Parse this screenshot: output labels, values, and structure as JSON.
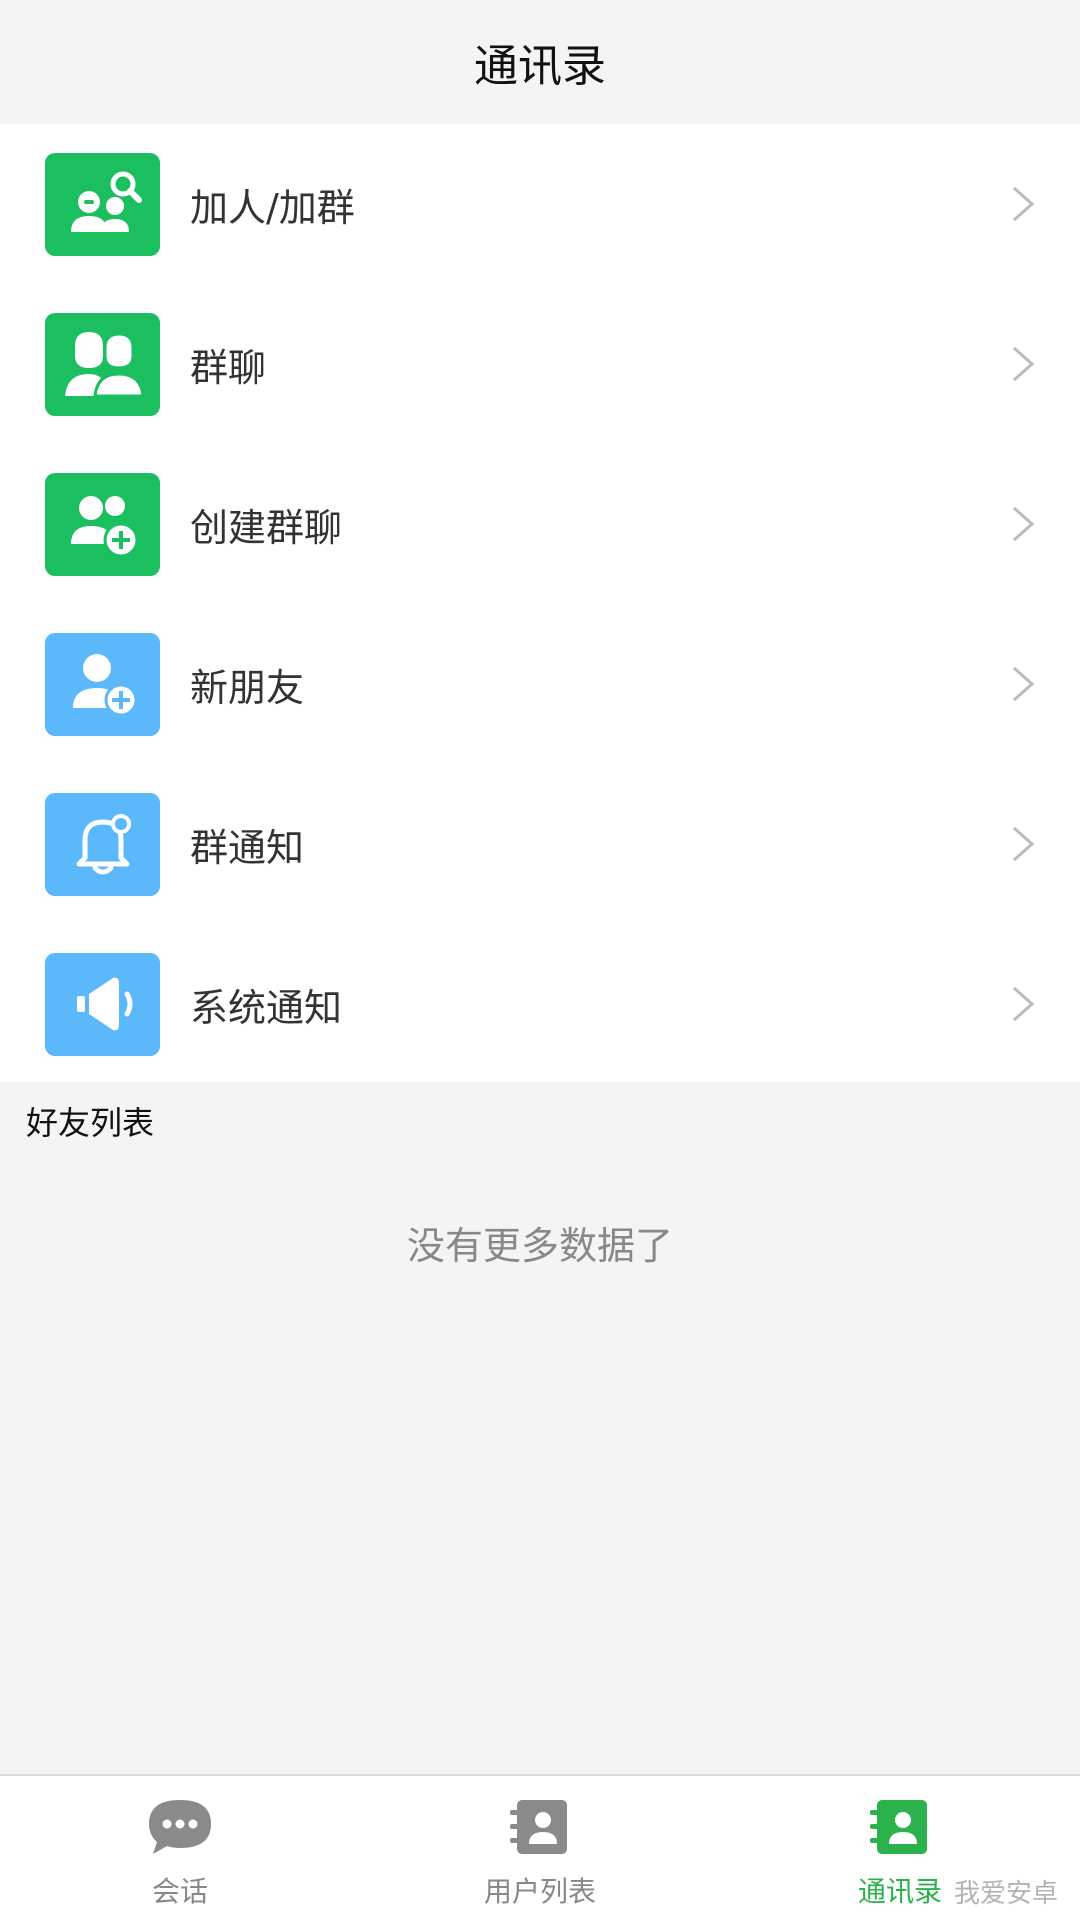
{
  "header": {
    "title": "通讯录"
  },
  "menu": {
    "items": [
      {
        "label": "加人/加群",
        "icon": "add-search-users-icon",
        "color": "#1bbf5f"
      },
      {
        "label": "群聊",
        "icon": "group-chat-icon",
        "color": "#1bbf5f"
      },
      {
        "label": "创建群聊",
        "icon": "create-group-icon",
        "color": "#1bbf5f"
      },
      {
        "label": "新朋友",
        "icon": "new-friend-icon",
        "color": "#5bb8fb"
      },
      {
        "label": "群通知",
        "icon": "bell-icon",
        "color": "#5bb8fb"
      },
      {
        "label": "系统通知",
        "icon": "speaker-icon",
        "color": "#5bb8fb"
      }
    ]
  },
  "friends": {
    "section_title": "好友列表",
    "empty_text": "没有更多数据了"
  },
  "tabbar": {
    "tabs": [
      {
        "label": "会话",
        "icon": "chat-bubble-icon",
        "active": false
      },
      {
        "label": "用户列表",
        "icon": "user-list-icon",
        "active": false
      },
      {
        "label": "通讯录",
        "icon": "contacts-icon",
        "active": true
      }
    ],
    "active_color": "#2bb24c",
    "inactive_color": "#888888"
  },
  "watermark": {
    "text": "我爱安卓"
  }
}
